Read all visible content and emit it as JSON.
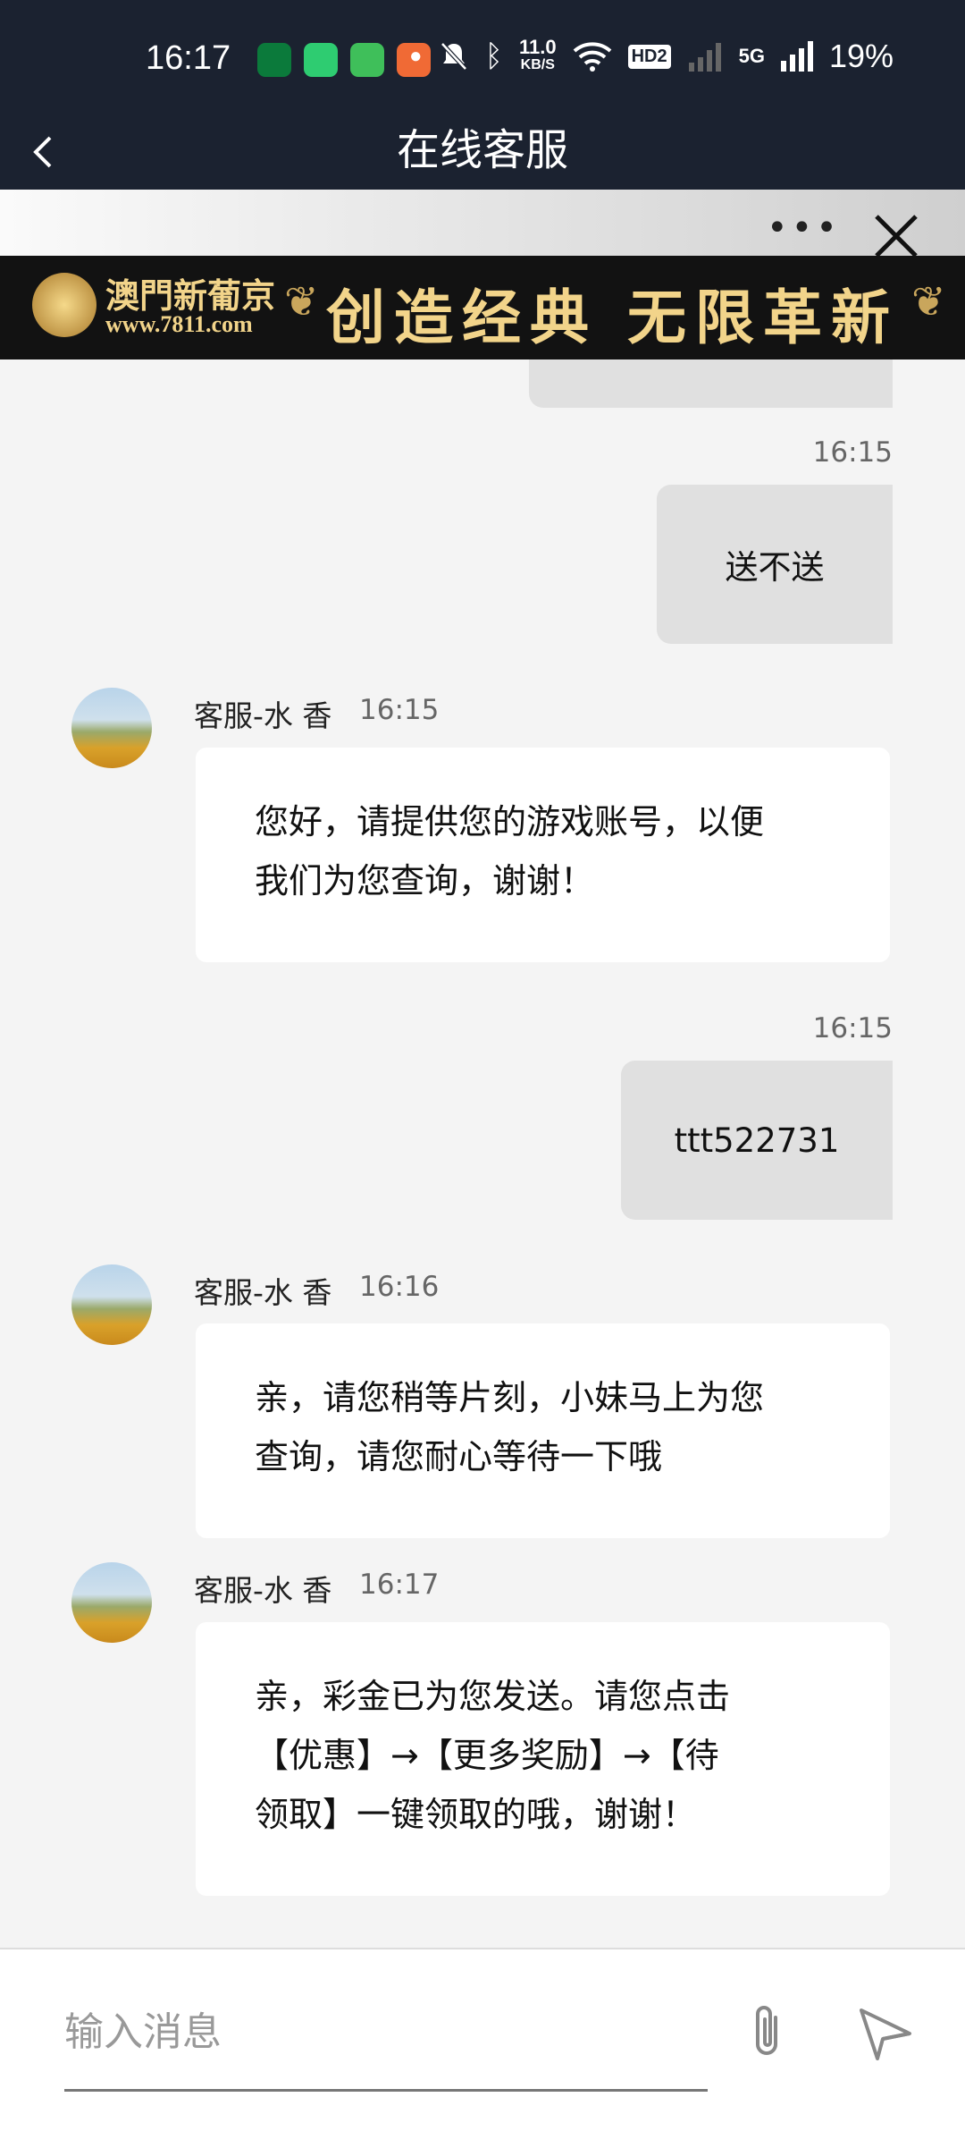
{
  "status_bar": {
    "time": "16:17",
    "net_speed_value": "11.0",
    "net_speed_unit": "KB/S",
    "hd": "HD2",
    "network": "5G",
    "battery": "19%"
  },
  "nav": {
    "title": "在线客服"
  },
  "banner": {
    "brand_cn": "澳門新葡京",
    "brand_url": "www.7811.com",
    "slogan": "创造经典 无限革新"
  },
  "messages": [
    {
      "side": "right",
      "time": "16:15",
      "text": "送不送"
    },
    {
      "side": "left",
      "sender": "客服-水 香",
      "time": "16:15",
      "lines": [
        "您好，请提供您的游戏账号，以便",
        "我们为您查询，谢谢！"
      ]
    },
    {
      "side": "right",
      "time": "16:15",
      "text": "ttt522731"
    },
    {
      "side": "left",
      "sender": "客服-水 香",
      "time": "16:16",
      "lines": [
        "亲，请您稍等片刻，小妹马上为您",
        "查询，请您耐心等待一下哦"
      ]
    },
    {
      "side": "left",
      "sender": "客服-水 香",
      "time": "16:17",
      "lines": [
        "亲，彩金已为您发送。请您点击",
        "【优惠】→【更多奖励】→【待",
        "领取】一键领取的哦，谢谢！"
      ]
    }
  ],
  "input": {
    "placeholder": "输入消息"
  },
  "colors": {
    "header_bg": "#1b2230",
    "bubble_right": "#e0e0e0",
    "bubble_left": "#ffffff",
    "gold": "#f2d48a"
  }
}
